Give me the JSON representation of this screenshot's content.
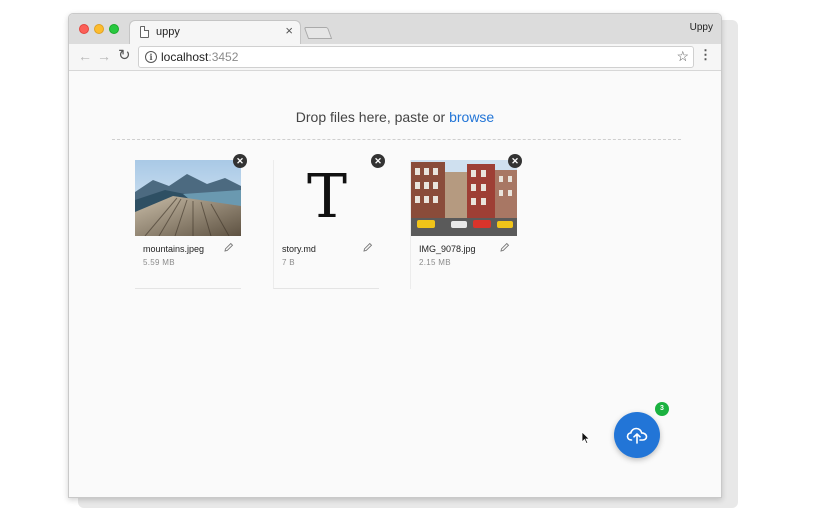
{
  "browser": {
    "tab_title": "uppy",
    "tab_close": "×",
    "profile_name": "Uppy",
    "url_host": "localhost",
    "url_port": ":3452",
    "nav_back": "←",
    "nav_forward": "→",
    "reload": "↻",
    "bookmark": "☆",
    "menu": "⋮"
  },
  "dropzone": {
    "text": "Drop files here, paste or ",
    "browse_label": "browse"
  },
  "files": [
    {
      "name": "mountains.jpeg",
      "size": "5.59 MB",
      "remove": "✕"
    },
    {
      "name": "story.md",
      "size": "7 B",
      "remove": "✕",
      "preview_letter": "T"
    },
    {
      "name": "IMG_9078.jpg",
      "size": "2.15 MB",
      "remove": "✕"
    }
  ],
  "upload_button": {
    "badge_count": "3",
    "accent": "#2275d7",
    "badge_color": "#1bb240"
  }
}
